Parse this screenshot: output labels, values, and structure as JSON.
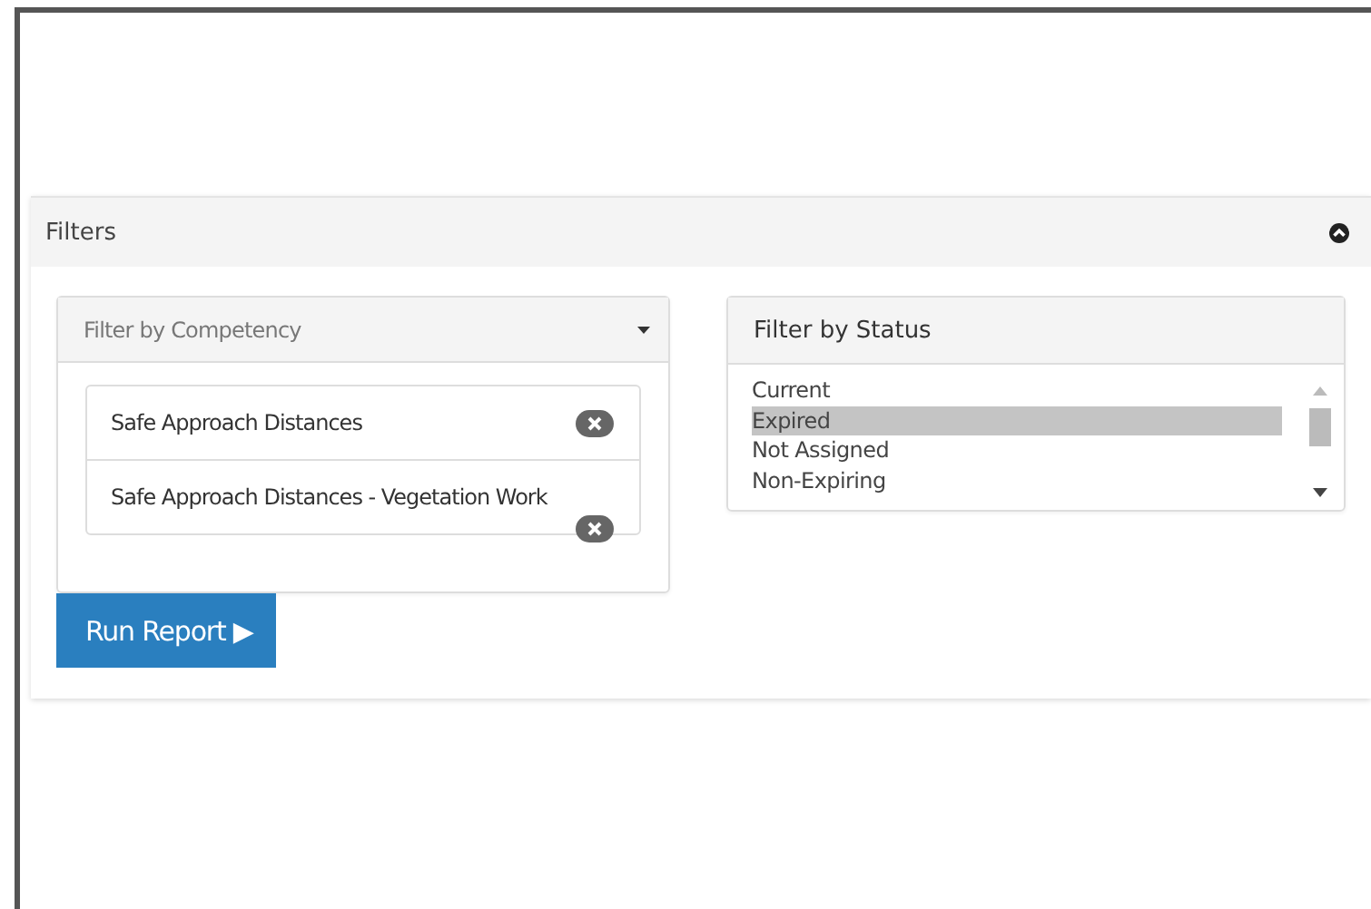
{
  "panel": {
    "title": "Filters",
    "expanded": true
  },
  "competency": {
    "placeholder": "Filter by Competency",
    "selected_items": [
      "Safe Approach Distances",
      "Safe Approach Distances - Vegetation Work"
    ]
  },
  "status": {
    "title": "Filter by Status",
    "options": [
      {
        "label": "Current",
        "selected": false
      },
      {
        "label": "Expired",
        "selected": true
      },
      {
        "label": "Not Assigned",
        "selected": false
      },
      {
        "label": "Non-Expiring",
        "selected": false
      }
    ]
  },
  "run_button": {
    "label": "Run Report",
    "icon": "▶"
  }
}
